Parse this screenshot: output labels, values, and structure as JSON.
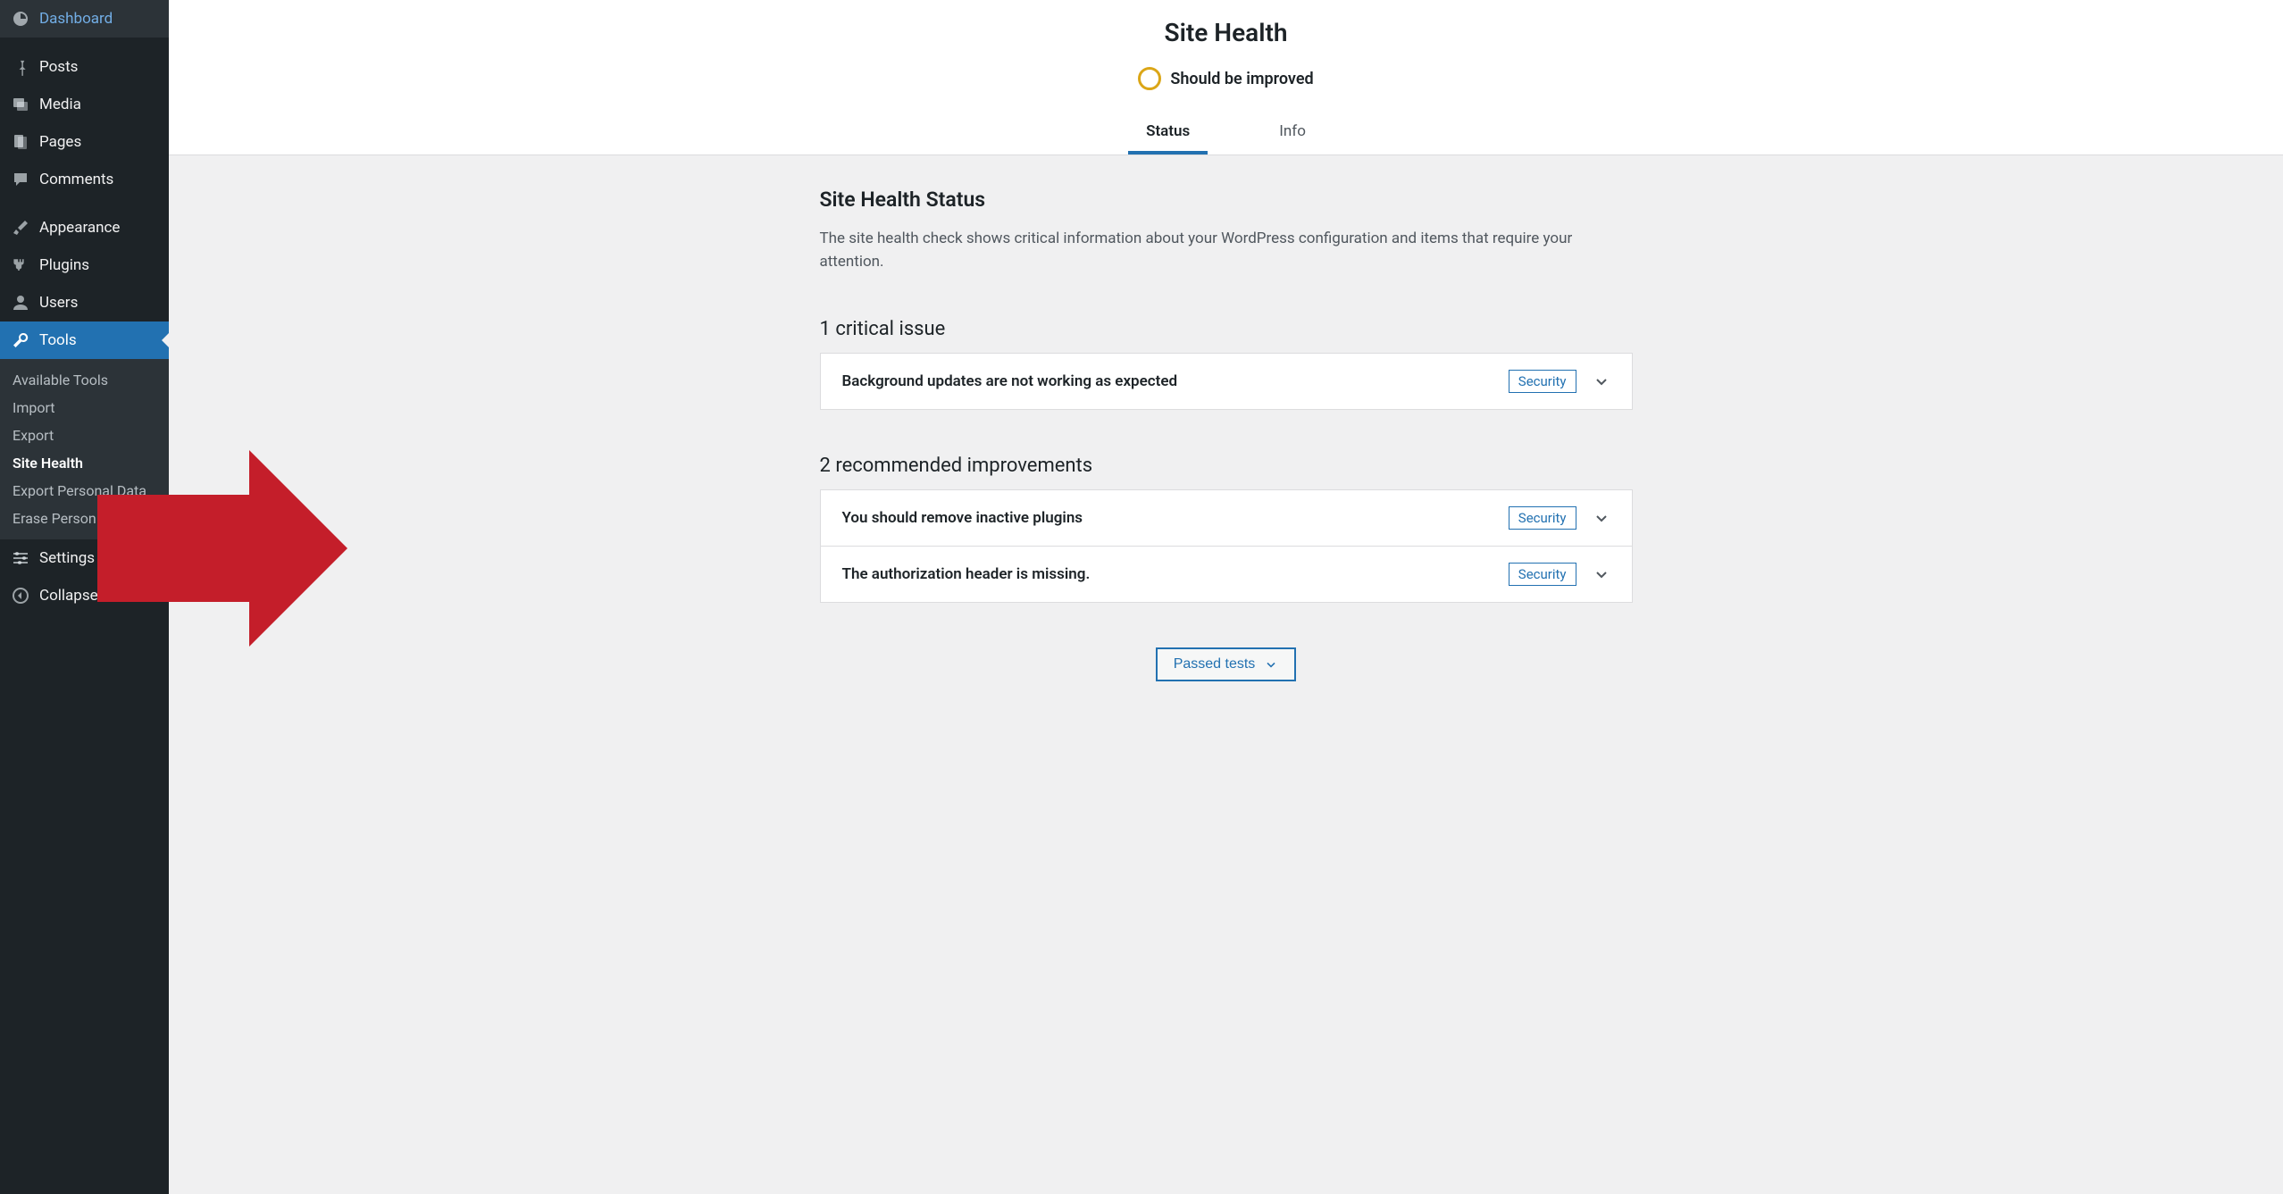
{
  "sidebar": {
    "main_items": [
      {
        "label": "Dashboard",
        "icon": "dashboard"
      },
      {
        "label": "Posts",
        "icon": "pin"
      },
      {
        "label": "Media",
        "icon": "media"
      },
      {
        "label": "Pages",
        "icon": "pages"
      },
      {
        "label": "Comments",
        "icon": "comment"
      },
      {
        "label": "Appearance",
        "icon": "brush"
      },
      {
        "label": "Plugins",
        "icon": "plug"
      },
      {
        "label": "Users",
        "icon": "user"
      },
      {
        "label": "Tools",
        "icon": "wrench",
        "active": true
      },
      {
        "label": "Settings",
        "icon": "sliders"
      },
      {
        "label": "Collapse menu",
        "icon": "collapse"
      }
    ],
    "submenu": [
      {
        "label": "Available Tools"
      },
      {
        "label": "Import"
      },
      {
        "label": "Export"
      },
      {
        "label": "Site Health",
        "current": true
      },
      {
        "label": "Export Personal Data"
      },
      {
        "label": "Erase Person"
      }
    ]
  },
  "header": {
    "title": "Site Health",
    "status_text": "Should be improved",
    "tabs": [
      {
        "label": "Status",
        "active": true
      },
      {
        "label": "Info"
      }
    ]
  },
  "content": {
    "section_title": "Site Health Status",
    "section_desc": "The site health check shows critical information about your WordPress configuration and items that require your attention.",
    "critical_heading": "1 critical issue",
    "critical_issues": [
      {
        "title": "Background updates are not working as expected",
        "badge": "Security"
      }
    ],
    "recommended_heading": "2 recommended improvements",
    "recommended_issues": [
      {
        "title": "You should remove inactive plugins",
        "badge": "Security"
      },
      {
        "title": "The authorization header is missing.",
        "badge": "Security"
      }
    ],
    "passed_button": "Passed tests"
  }
}
